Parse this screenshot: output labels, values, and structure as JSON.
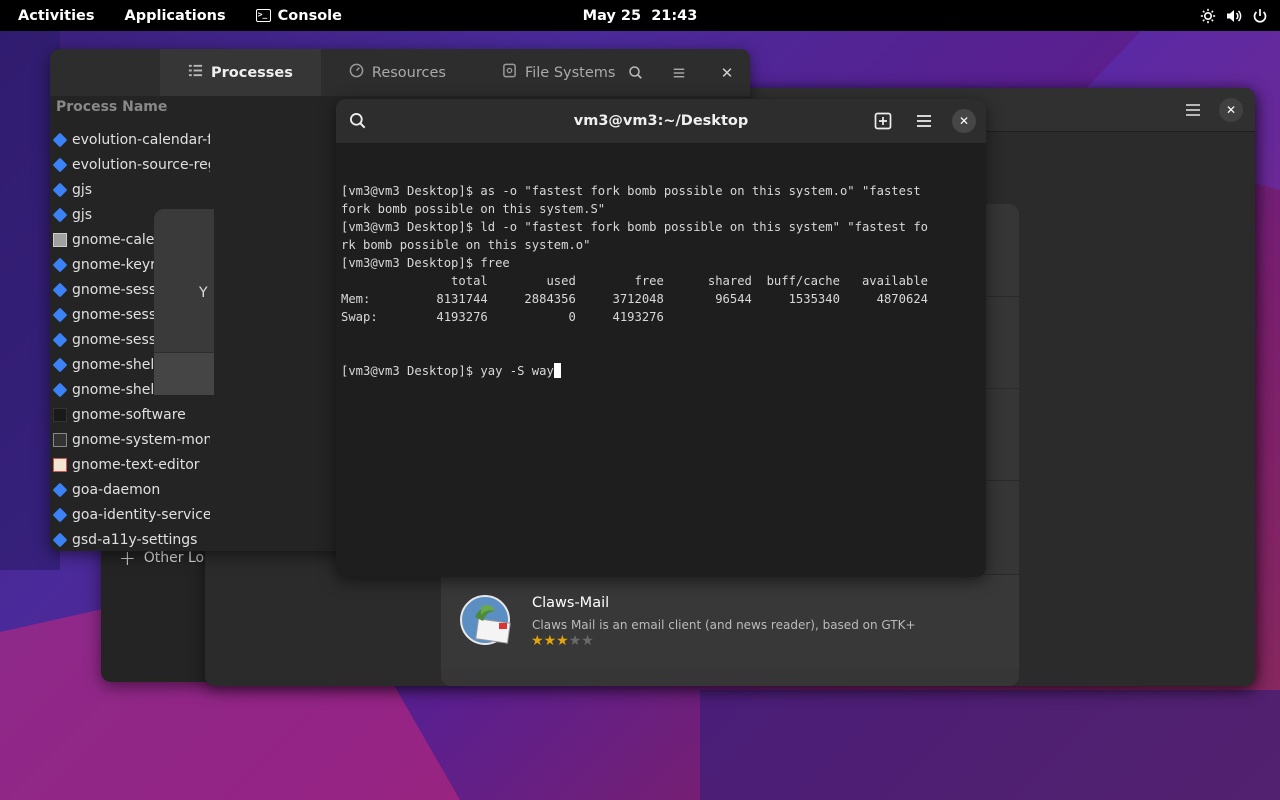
{
  "topbar": {
    "activities": "Activities",
    "applications": "Applications",
    "console_app": "Console",
    "date": "May 25",
    "time": "21:43"
  },
  "system_monitor": {
    "tabs": [
      {
        "label": "Processes",
        "icon": "list-icon",
        "active": true
      },
      {
        "label": "Resources",
        "icon": "gauge-icon",
        "active": false
      },
      {
        "label": "File Systems",
        "icon": "disk-icon",
        "active": false
      }
    ],
    "column_header": "Process Name",
    "processes": [
      {
        "name": "evolution-calendar-f",
        "icon": "diamond"
      },
      {
        "name": "evolution-source-reg",
        "icon": "diamond"
      },
      {
        "name": "gjs",
        "icon": "diamond"
      },
      {
        "name": "gjs",
        "icon": "diamond"
      },
      {
        "name": "gnome-calen",
        "icon": "app"
      },
      {
        "name": "gnome-keyri",
        "icon": "diamond"
      },
      {
        "name": "gnome-sessi",
        "icon": "diamond"
      },
      {
        "name": "gnome-sessi",
        "icon": "diamond"
      },
      {
        "name": "gnome-sessi",
        "icon": "diamond"
      },
      {
        "name": "gnome-shell",
        "icon": "diamond"
      },
      {
        "name": "gnome-shell-c",
        "icon": "diamond"
      },
      {
        "name": "gnome-software",
        "icon": "bag"
      },
      {
        "name": "gnome-system-moni",
        "icon": "mon"
      },
      {
        "name": "gnome-text-editor",
        "icon": "edit"
      },
      {
        "name": "goa-daemon",
        "icon": "diamond"
      },
      {
        "name": "goa-identity-service",
        "icon": "diamond"
      },
      {
        "name": "gsd-a11y-settings",
        "icon": "diamond"
      }
    ]
  },
  "files": {
    "other_locations": "Other Loc"
  },
  "dialog": {
    "text": "Y"
  },
  "software": {
    "app": {
      "name": "Claws-Mail",
      "description": "Claws Mail is an email client (and news reader), based on GTK+",
      "rating_stars": 3,
      "rating_max": 5
    }
  },
  "console": {
    "title": "vm3@vm3:~/Desktop",
    "lines": [
      "[vm3@vm3 Desktop]$ as -o \"fastest fork bomb possible on this system.o\" \"fastest",
      "fork bomb possible on this system.S\"",
      "[vm3@vm3 Desktop]$ ld -o \"fastest fork bomb possible on this system\" \"fastest fo",
      "rk bomb possible on this system.o\"",
      "[vm3@vm3 Desktop]$ free",
      "               total        used        free      shared  buff/cache   available",
      "Mem:         8131744     2884356     3712048       96544     1535340     4870624",
      "Swap:        4193276           0     4193276"
    ],
    "prompt_line": "[vm3@vm3 Desktop]$ yay -S way"
  },
  "colors": {
    "accent_star": "#e5a50a",
    "terminal_bg": "#1e1e1e",
    "process_icon": "#3b82f6"
  }
}
